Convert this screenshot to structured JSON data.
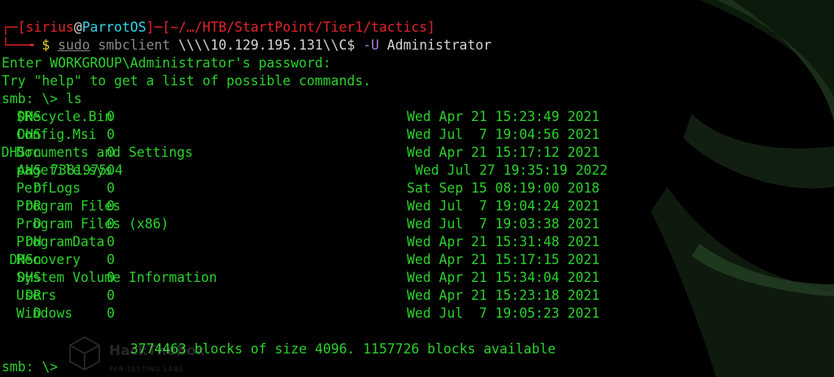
{
  "prompt": {
    "user": "sirius",
    "at": "@",
    "host": "ParrotOS",
    "path": "~/…/HTB/StartPoint/Tier1/tactics",
    "dollar": "$",
    "sudo": "sudo",
    "command": "smbclient",
    "share_arg": "\\\\\\\\10.129.195.131\\\\C$",
    "flag": "-U",
    "username": "Administrator"
  },
  "output": {
    "password_prompt": "Enter WORKGROUP\\Administrator's password:",
    "help_hint": "Try \"help\" to get a list of possible commands.",
    "smb_prompt_1": "smb: \\> ls",
    "summary": "3774463 blocks of size 4096. 1157726 blocks available",
    "smb_prompt_2": "smb: \\>"
  },
  "listing": [
    {
      "name": "$Recycle.Bin",
      "attr": "DHS",
      "size": "0",
      "date": "Wed Apr 21 15:23:49 2021"
    },
    {
      "name": "Config.Msi",
      "attr": "DHS",
      "size": "0",
      "date": "Wed Jul  7 19:04:56 2021"
    },
    {
      "name": "Documents and Settings",
      "attr": "DHSrn",
      "size": "0",
      "date": "Wed Apr 21 15:17:12 2021"
    },
    {
      "name": "pagefile.sys",
      "attr": "AHS",
      "size": "738197504",
      "date": "Wed Jul 27 19:35:19 2022"
    },
    {
      "name": "PerfLogs",
      "attr": "D",
      "size": "0",
      "date": "Sat Sep 15 08:19:00 2018"
    },
    {
      "name": "Program Files",
      "attr": "DR",
      "size": "0",
      "date": "Wed Jul  7 19:04:24 2021"
    },
    {
      "name": "Program Files (x86)",
      "attr": "D",
      "size": "0",
      "date": "Wed Jul  7 19:03:38 2021"
    },
    {
      "name": "ProgramData",
      "attr": "DH",
      "size": "0",
      "date": "Wed Apr 21 15:31:48 2021"
    },
    {
      "name": "Recovery",
      "attr": "DHSn",
      "size": "0",
      "date": "Wed Apr 21 15:17:15 2021"
    },
    {
      "name": "System Volume Information",
      "attr": "DHS",
      "size": "0",
      "date": "Wed Apr 21 15:34:04 2021"
    },
    {
      "name": "Users",
      "attr": "DR",
      "size": "0",
      "date": "Wed Apr 21 15:23:18 2021"
    },
    {
      "name": "Windows",
      "attr": "D",
      "size": "0",
      "date": "Wed Jul  7 19:05:23 2021"
    }
  ],
  "watermark": {
    "title": "HackTheBox",
    "subtitle": "PEN-TESTING LABS"
  },
  "colors": {
    "background": "#000000",
    "output_green": "#2bd12b",
    "prompt_red": "#e3242b",
    "host_cyan": "#35d4e8",
    "dollar_yellow": "#f2d72a"
  }
}
